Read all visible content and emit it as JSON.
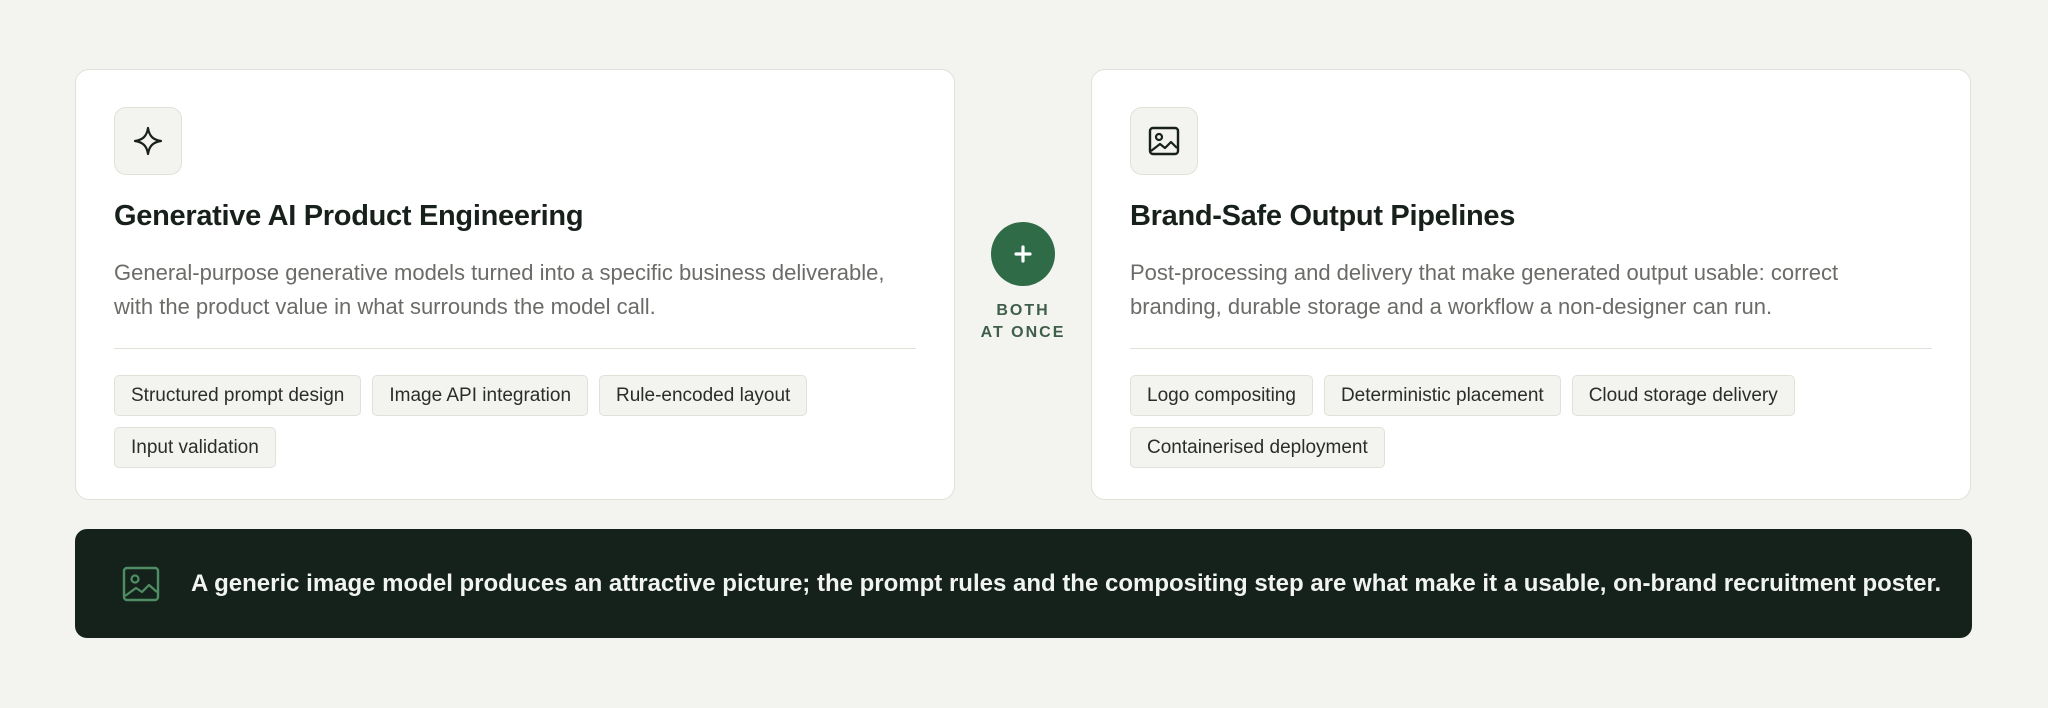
{
  "colors": {
    "page_bg": "#f3f3ef",
    "card_bg": "#ffffff",
    "accent_green": "#2e6b46",
    "banner_bg": "#15221b",
    "title_text": "#17201a",
    "body_text": "#6b6b68"
  },
  "cards": [
    {
      "icon": "sparkle-icon",
      "title": "Generative AI Product Engineering",
      "description": "General-purpose generative models turned into a specific business deliverable, with the product value in what surrounds the model call.",
      "chips": [
        "Structured prompt design",
        "Image API integration",
        "Rule-encoded layout",
        "Input validation"
      ]
    },
    {
      "icon": "image-icon",
      "title": "Brand-Safe Output Pipelines",
      "description": "Post-processing and delivery that make generated output usable: correct branding, durable storage and a workflow a non-designer can run.",
      "chips": [
        "Logo compositing",
        "Deterministic placement",
        "Cloud storage delivery",
        "Containerised deployment"
      ]
    }
  ],
  "connector": {
    "icon": "plus-icon",
    "label_line1": "BOTH",
    "label_line2": "AT ONCE"
  },
  "banner": {
    "icon": "image-icon",
    "text": "A generic image model produces an attractive picture; the prompt rules and the compositing step are what make it a usable, on-brand recruitment poster."
  }
}
